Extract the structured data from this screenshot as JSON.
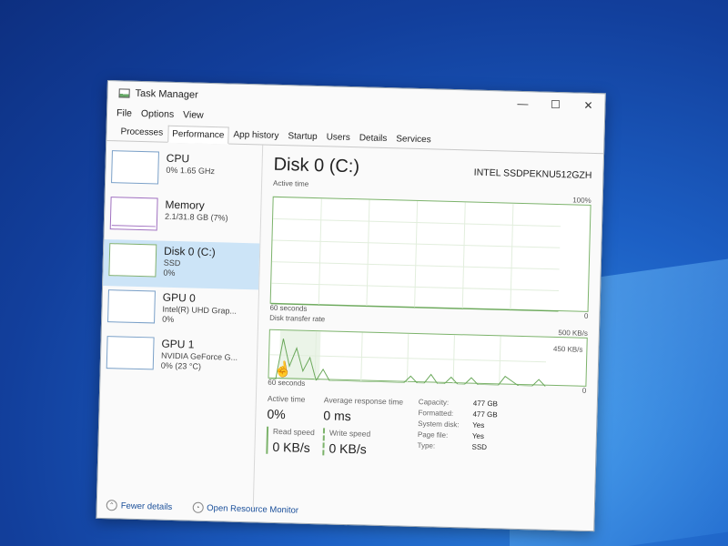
{
  "window": {
    "title": "Task Manager",
    "menu": [
      "File",
      "Options",
      "View"
    ],
    "tabs": [
      "Processes",
      "Performance",
      "App history",
      "Startup",
      "Users",
      "Details",
      "Services"
    ],
    "controls": {
      "minimize": "—",
      "maximize": "☐",
      "close": "✕"
    }
  },
  "sidebar": [
    {
      "name": "CPU",
      "sub1": "0% 1.65 GHz",
      "sub2": ""
    },
    {
      "name": "Memory",
      "sub1": "2.1/31.8 GB (7%)",
      "sub2": ""
    },
    {
      "name": "Disk 0 (C:)",
      "sub1": "SSD",
      "sub2": "0%"
    },
    {
      "name": "GPU 0",
      "sub1": "Intel(R) UHD Grap...",
      "sub2": "0%"
    },
    {
      "name": "GPU 1",
      "sub1": "NVIDIA GeForce G...",
      "sub2": "0% (23 °C)"
    }
  ],
  "main": {
    "title": "Disk 0 (C:)",
    "model": "INTEL SSDPEKNU512GZH",
    "active_time_label": "Active time",
    "active_time_max": "100%",
    "active_time_min": "0",
    "graph_time": "60 seconds",
    "transfer_label": "Disk transfer rate",
    "transfer_max": "500 KB/s",
    "transfer_mid": "450 KB/s",
    "transfer_min": "0",
    "transfer_time": "60 seconds",
    "transfer_spikes": [
      0,
      0,
      0.9,
      0.3,
      0.7,
      0.2,
      0.5,
      0,
      0.25,
      0,
      0,
      0,
      0,
      0,
      0,
      0,
      0,
      0,
      0,
      0,
      0,
      0.15,
      0,
      0,
      0.2,
      0,
      0,
      0.15,
      0,
      0,
      0.15,
      0,
      0,
      0,
      0,
      0.2,
      0.1,
      0,
      0,
      0,
      0.15,
      0
    ]
  },
  "stats": {
    "active_time": {
      "label": "Active time",
      "value": "0%"
    },
    "avg_response": {
      "label": "Average response time",
      "value": "0 ms"
    },
    "read_speed": {
      "label": "Read speed",
      "value": "0 KB/s"
    },
    "write_speed": {
      "label": "Write speed",
      "value": "0 KB/s"
    }
  },
  "properties": [
    {
      "key": "Capacity:",
      "value": "477 GB"
    },
    {
      "key": "Formatted:",
      "value": "477 GB"
    },
    {
      "key": "System disk:",
      "value": "Yes"
    },
    {
      "key": "Page file:",
      "value": "Yes"
    },
    {
      "key": "Type:",
      "value": "SSD"
    }
  ],
  "footer": {
    "fewer_details": "Fewer details",
    "open_monitor": "Open Resource Monitor"
  }
}
